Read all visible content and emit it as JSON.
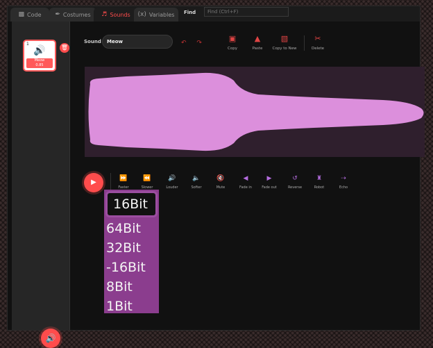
{
  "tabs": [
    {
      "label": "Code",
      "icon": "code-icon"
    },
    {
      "label": "Costumes",
      "icon": "brush-icon"
    },
    {
      "label": "Sounds",
      "icon": "speaker-icon"
    },
    {
      "label": "Variables",
      "icon": "variables-icon"
    }
  ],
  "find": {
    "label": "Find",
    "placeholder": "Find (Ctrl+F)"
  },
  "sidebar": {
    "sound_tile": {
      "number": "1",
      "name": "Meow",
      "duration": "0.85"
    }
  },
  "editor": {
    "sound_label": "Sound",
    "sound_name": "Meow",
    "undo_icon": "undo-icon",
    "redo_icon": "redo-icon",
    "top_buttons": [
      {
        "label": "Copy",
        "icon": "copy-icon"
      },
      {
        "label": "Paste",
        "icon": "paste-icon"
      },
      {
        "label": "Copy to New",
        "icon": "copy-to-new-icon"
      },
      {
        "label": "Delete",
        "icon": "scissors-icon"
      }
    ],
    "effects": [
      {
        "label": "Faster",
        "icon": "faster-icon"
      },
      {
        "label": "Slower",
        "icon": "slower-icon"
      },
      {
        "label": "Louder",
        "icon": "louder-icon"
      },
      {
        "label": "Softer",
        "icon": "softer-icon"
      },
      {
        "label": "Mute",
        "icon": "mute-icon"
      },
      {
        "label": "Fade in",
        "icon": "fade-in-icon"
      },
      {
        "label": "Fade out",
        "icon": "fade-out-icon"
      },
      {
        "label": "Reverse",
        "icon": "reverse-icon"
      },
      {
        "label": "Robot",
        "icon": "robot-icon"
      },
      {
        "label": "Echo",
        "icon": "echo-icon"
      }
    ]
  },
  "bit_dropdown": {
    "selected": "16Bit",
    "options": [
      "64Bit",
      "32Bit",
      "-16Bit",
      "8Bit",
      "1Bit"
    ]
  },
  "colors": {
    "accent": "#ff4c4c",
    "waveform_fill": "#dc8fdc",
    "waveform_bg": "#2f1f2d",
    "dropdown_bg": "#8b3d8e",
    "effect_icon": "#b56de0"
  }
}
